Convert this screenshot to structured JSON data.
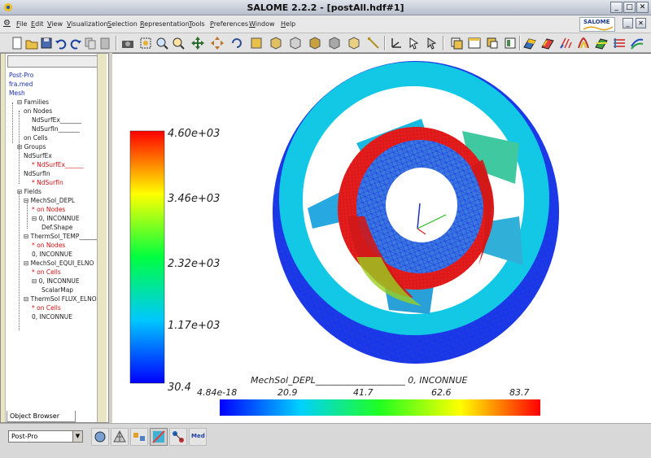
{
  "window": {
    "title": "SALOME 2.2.2 - [postAll.hdf#1]"
  },
  "menu": [
    "File",
    "Edit",
    "View",
    "Visualization",
    "Selection",
    "Representation",
    "Tools",
    "Preferences",
    "Window",
    "Help"
  ],
  "logo_text": "SALOME",
  "browser": {
    "tab_label": "Object Browser",
    "items": [
      {
        "text": "Post-Pro",
        "color": "blue"
      },
      {
        "text": "fra.med",
        "color": "blue"
      },
      {
        "text": "Mesh",
        "color": "blue"
      },
      {
        "text": "Families",
        "color": "normal"
      },
      {
        "text": "on Nodes",
        "color": "normal"
      },
      {
        "text": "NdSurfEx_______",
        "color": "normal"
      },
      {
        "text": "NdSurfIn_______",
        "color": "normal"
      },
      {
        "text": "on Cells",
        "color": "normal"
      },
      {
        "text": "Groups",
        "color": "normal"
      },
      {
        "text": "NdSurfEx",
        "color": "normal"
      },
      {
        "text": "* NdSurfEx______",
        "color": "red"
      },
      {
        "text": "NdSurfIn",
        "color": "normal"
      },
      {
        "text": "* NdSurfIn",
        "color": "red"
      },
      {
        "text": "Fields",
        "color": "normal"
      },
      {
        "text": "MechSol_DEPL",
        "color": "normal"
      },
      {
        "text": "* on Nodes",
        "color": "red"
      },
      {
        "text": "0, INCONNUE",
        "color": "normal"
      },
      {
        "text": "Def.Shape",
        "color": "normal"
      },
      {
        "text": "ThermSol_TEMP______",
        "color": "normal"
      },
      {
        "text": "* on Nodes",
        "color": "red"
      },
      {
        "text": "0, INCONNUE",
        "color": "normal"
      },
      {
        "text": "MechSol_EQUI_ELNO",
        "color": "normal"
      },
      {
        "text": "* on Cells",
        "color": "red"
      },
      {
        "text": "0, INCONNUE",
        "color": "normal"
      },
      {
        "text": "ScalarMap",
        "color": "normal"
      },
      {
        "text": "ThermSol FLUX_ELNO",
        "color": "normal"
      },
      {
        "text": "* on Cells",
        "color": "red"
      },
      {
        "text": "0, INCONNUE",
        "color": "normal"
      }
    ]
  },
  "viewer": {
    "vertical_bar": {
      "title": "",
      "labels": [
        "4.60e+03",
        "3.46e+03",
        "2.32e+03",
        "1.17e+03",
        "30.4"
      ]
    },
    "horizontal_bar": {
      "title": "MechSol_DEPL____________________ 0, INCONNUE",
      "labels": [
        "4.84e-18",
        "20.9",
        "41.7",
        "62.6",
        "83.7"
      ]
    }
  },
  "statusbar": {
    "module_combo": "Post-Pro"
  },
  "colors": {
    "background": "#ffffff",
    "chrome": "#d4d0c8",
    "high": "#ff0000",
    "low": "#0000ff"
  }
}
